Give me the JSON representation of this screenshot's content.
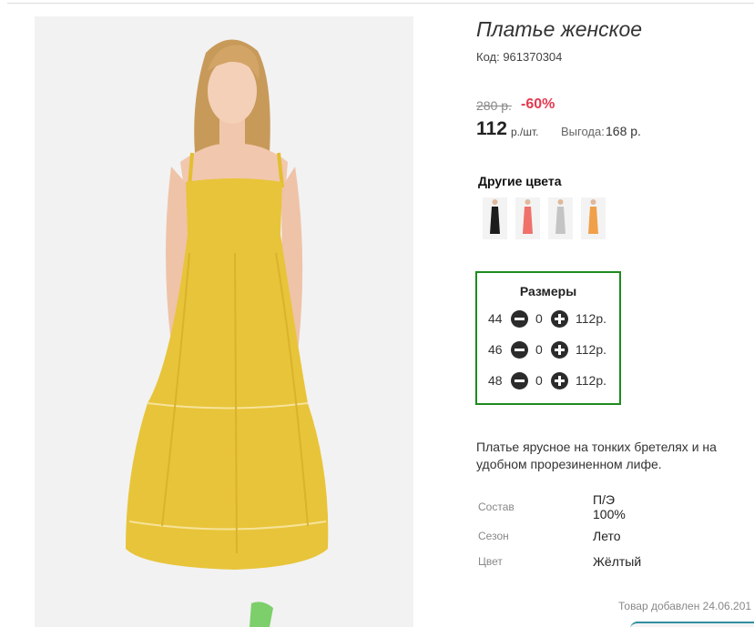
{
  "product": {
    "title": "Платье женское",
    "code": "Код: 961370304",
    "old_price": "280 р.",
    "discount": "-60%",
    "price": "112",
    "price_unit": "р./шт.",
    "benefit_label": "Выгода:",
    "benefit_value": "168 р.",
    "main_dress_color": "#e8c43a"
  },
  "other_colors": {
    "title": "Другие цвета",
    "items": [
      {
        "name": "black",
        "color": "#1c1c1c"
      },
      {
        "name": "coral",
        "color": "#f0706a"
      },
      {
        "name": "grey",
        "color": "#c4c4c4"
      },
      {
        "name": "orange",
        "color": "#f0a04a"
      }
    ]
  },
  "sizes": {
    "title": "Размеры",
    "rows": [
      {
        "size": "44",
        "qty": "0",
        "price": "112р."
      },
      {
        "size": "46",
        "qty": "0",
        "price": "112р."
      },
      {
        "size": "48",
        "qty": "0",
        "price": "112р."
      }
    ],
    "border_color": "#1e8a1e"
  },
  "description": "Платье ярусное на тонких бретелях и на удобном прорезиненном лифе.",
  "specs": [
    {
      "label": "Состав",
      "value": "П/Э 100%"
    },
    {
      "label": "Сезон",
      "value": "Лето"
    },
    {
      "label": "Цвет",
      "value": "Жёлтый"
    }
  ],
  "added_text": "Товар добавлен 24.06.201",
  "colors": {
    "discount": "#e5384f",
    "accent_green": "#1e8a1e"
  }
}
